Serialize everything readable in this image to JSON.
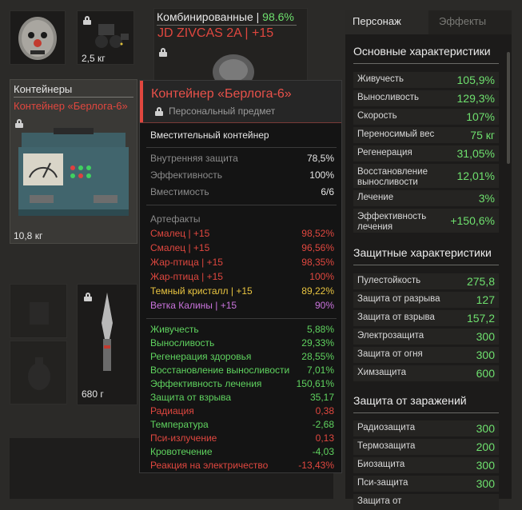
{
  "inventory": {
    "slot_weight_2": "2,5 кг",
    "container_weight": "10,8 кг",
    "knife_weight": "680 г"
  },
  "weapon": {
    "category": "Комбинированные",
    "category_sep": "|",
    "percent": "98.6%",
    "name": "JD ZIVCAS 2A",
    "upgrade": "| +15"
  },
  "containers": {
    "title": "Контейнеры",
    "item_name": "Контейнер «Берлога-6»"
  },
  "tooltip": {
    "title": "Контейнер «Берлога-6»",
    "subtitle": "Персональный предмет",
    "description": "Вместительный контейнер",
    "props": [
      {
        "label": "Внутренняя защита",
        "value": "78,5%"
      },
      {
        "label": "Эффективность",
        "value": "100%"
      },
      {
        "label": "Вместимость",
        "value": "6/6"
      }
    ],
    "artifacts_header": "Артефакты",
    "artifacts": [
      {
        "label": "Смалец | +15",
        "value": "98,52%",
        "color": "#e0473f"
      },
      {
        "label": "Смалец | +15",
        "value": "96,56%",
        "color": "#e0473f"
      },
      {
        "label": "Жар-птица | +15",
        "value": "98,35%",
        "color": "#e0473f"
      },
      {
        "label": "Жар-птица | +15",
        "value": "100%",
        "color": "#e0473f"
      },
      {
        "label": "Темный кристалл | +15",
        "value": "89,22%",
        "color": "#e8c440"
      },
      {
        "label": "Ветка Калины | +15",
        "value": "90%",
        "color": "#c973dc"
      }
    ],
    "effects": [
      {
        "label": "Живучесть",
        "value": "5,88%",
        "color": "#5fd35f"
      },
      {
        "label": "Выносливость",
        "value": "29,33%",
        "color": "#5fd35f"
      },
      {
        "label": "Регенерация здоровья",
        "value": "28,55%",
        "color": "#5fd35f"
      },
      {
        "label": "Восстановление выносливости",
        "value": "7,01%",
        "color": "#5fd35f"
      },
      {
        "label": "Эффективность лечения",
        "value": "150,61%",
        "color": "#5fd35f"
      },
      {
        "label": "Защита от взрыва",
        "value": "35,17",
        "color": "#5fd35f"
      },
      {
        "label": "Радиация",
        "value": "0,38",
        "color": "#e0473f"
      },
      {
        "label": "Температура",
        "value": "-2,68",
        "color": "#5fd35f"
      },
      {
        "label": "Пси-излучение",
        "value": "0,13",
        "color": "#e0473f"
      },
      {
        "label": "Кровотечение",
        "value": "-4,03",
        "color": "#5fd35f"
      },
      {
        "label": "Реакция на электричество",
        "value": "-13,43%",
        "color": "#e0473f"
      }
    ]
  },
  "panel": {
    "tabs": [
      "Персонаж",
      "Эффекты"
    ],
    "main_title": "Основные характеристики",
    "main": [
      {
        "label": "Живучесть",
        "value": "105,9%"
      },
      {
        "label": "Выносливость",
        "value": "129,3%"
      },
      {
        "label": "Скорость",
        "value": "107%"
      },
      {
        "label": "Переносимый вес",
        "value": "75 кг"
      },
      {
        "label": "Регенерация",
        "value": "31,05%"
      },
      {
        "label": "Восстановление выносливости",
        "value": "12,01%"
      },
      {
        "label": "Лечение",
        "value": "3%"
      },
      {
        "label": "Эффективность лечения",
        "value": "+150,6%"
      }
    ],
    "prot_title": "Защитные характеристики",
    "prot": [
      {
        "label": "Пулестойкость",
        "value": "275,8"
      },
      {
        "label": "Защита от разрыва",
        "value": "127"
      },
      {
        "label": "Защита от взрыва",
        "value": "157,2"
      },
      {
        "label": "Электрозащита",
        "value": "300"
      },
      {
        "label": "Защита от огня",
        "value": "300"
      },
      {
        "label": "Химзащита",
        "value": "600"
      }
    ],
    "inf_title": "Защита от заражений",
    "inf": [
      {
        "label": "Радиозащита",
        "value": "300"
      },
      {
        "label": "Термозащита",
        "value": "200"
      },
      {
        "label": "Биозащита",
        "value": "300"
      },
      {
        "label": "Пси-защита",
        "value": "300"
      },
      {
        "label": "Защита от",
        "value": ""
      }
    ]
  }
}
